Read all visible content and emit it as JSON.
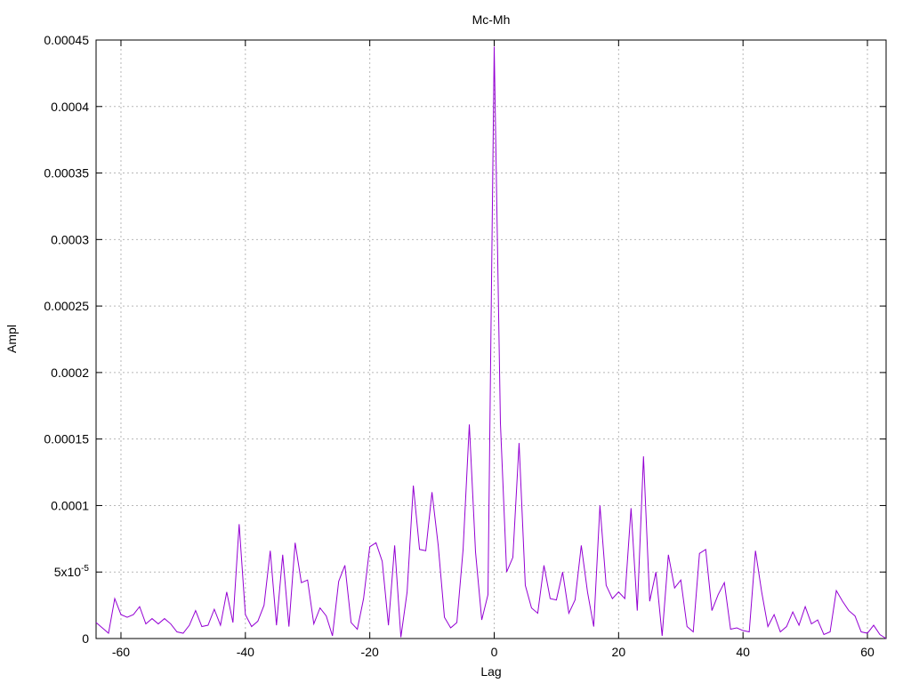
{
  "chart_data": {
    "type": "line",
    "title": "Mc-Mh",
    "xlabel": "Lag",
    "ylabel": "Ampl",
    "xlim": [
      -64,
      63
    ],
    "ylim": [
      0,
      0.00045
    ],
    "grid": true,
    "x_ticks": [
      -60,
      -40,
      -20,
      0,
      20,
      40,
      60
    ],
    "x_tick_labels": [
      "-60",
      "-40",
      "-20",
      "0",
      "20",
      "40",
      "60"
    ],
    "y_ticks": [
      0,
      5e-05,
      0.0001,
      0.00015,
      0.0002,
      0.00025,
      0.0003,
      0.00035,
      0.0004,
      0.00045
    ],
    "y_tick_labels": [
      "0",
      "5x10-5",
      "0.0001",
      "0.00015",
      "0.0002",
      "0.00025",
      "0.0003",
      "0.00035",
      "0.0004",
      "0.00045"
    ],
    "line_color": "#9400d3",
    "series": [
      {
        "x": [
          -64,
          -63,
          -62,
          -61,
          -60,
          -59,
          -58,
          -57,
          -56,
          -55,
          -54,
          -53,
          -52,
          -51,
          -50,
          -49,
          -48,
          -47,
          -46,
          -45,
          -44,
          -43,
          -42,
          -41,
          -40,
          -39,
          -38,
          -37,
          -36,
          -35,
          -34,
          -33,
          -32,
          -31,
          -30,
          -29,
          -28,
          -27,
          -26,
          -25,
          -24,
          -23,
          -22,
          -21,
          -20,
          -19,
          -18,
          -17,
          -16,
          -15,
          -14,
          -13,
          -12,
          -11,
          -10,
          -9,
          -8,
          -7,
          -6,
          -5,
          -4,
          -3,
          -2,
          -1,
          0,
          1,
          2,
          3,
          4,
          5,
          6,
          7,
          8,
          9,
          10,
          11,
          12,
          13,
          14,
          15,
          16,
          17,
          18,
          19,
          20,
          21,
          22,
          23,
          24,
          25,
          26,
          27,
          28,
          29,
          30,
          31,
          32,
          33,
          34,
          35,
          36,
          37,
          38,
          39,
          40,
          41,
          42,
          43,
          44,
          45,
          46,
          47,
          48,
          49,
          50,
          51,
          52,
          53,
          54,
          55,
          56,
          57,
          58,
          59,
          60,
          61,
          62,
          63
        ],
        "y": [
          1.2e-05,
          8e-06,
          4e-06,
          3e-05,
          1.8e-05,
          1.6e-05,
          1.8e-05,
          2.4e-05,
          1.1e-05,
          1.5e-05,
          1.1e-05,
          1.5e-05,
          1.1e-05,
          5e-06,
          4e-06,
          1e-05,
          2.1e-05,
          9e-06,
          1e-05,
          2.2e-05,
          1e-05,
          3.5e-05,
          1.2e-05,
          8.6e-05,
          1.8e-05,
          9e-06,
          1.3e-05,
          2.5e-05,
          6.6e-05,
          1e-05,
          6.3e-05,
          9e-06,
          7.2e-05,
          4.2e-05,
          4.4e-05,
          1.1e-05,
          2.3e-05,
          1.7e-05,
          2e-06,
          4.3e-05,
          5.5e-05,
          1.2e-05,
          7e-06,
          3e-05,
          6.9e-05,
          7.2e-05,
          5.8e-05,
          1e-05,
          7e-05,
          1e-06,
          3.5e-05,
          0.000115,
          6.7e-05,
          6.6e-05,
          0.00011,
          7e-05,
          1.6e-05,
          8e-06,
          1.2e-05,
          6.7e-05,
          0.000161,
          6.5e-05,
          1.4e-05,
          3.3e-05,
          0.000445,
          0.000162,
          5e-05,
          6.1e-05,
          0.000147,
          4e-05,
          2.3e-05,
          1.9e-05,
          5.5e-05,
          3e-05,
          2.9e-05,
          5e-05,
          1.9e-05,
          2.9e-05,
          7e-05,
          3.5e-05,
          9e-06,
          0.0001,
          4e-05,
          3e-05,
          3.5e-05,
          3e-05,
          9.8e-05,
          2.1e-05,
          0.000137,
          2.8e-05,
          5e-05,
          2e-06,
          6.3e-05,
          3.8e-05,
          4.4e-05,
          9e-06,
          5e-06,
          6.4e-05,
          6.7e-05,
          2.1e-05,
          3.3e-05,
          4.2e-05,
          7e-06,
          8e-06,
          6e-06,
          5e-06,
          6.6e-05,
          3.5e-05,
          9e-06,
          1.8e-05,
          5e-06,
          9e-06,
          2e-05,
          1e-05,
          2.4e-05,
          1.1e-05,
          1.4e-05,
          3e-06,
          5e-06,
          3.6e-05,
          2.8e-05,
          2.1e-05,
          1.7e-05,
          5e-06,
          4e-06,
          1e-05,
          3e-06,
          0.0
        ]
      }
    ]
  }
}
